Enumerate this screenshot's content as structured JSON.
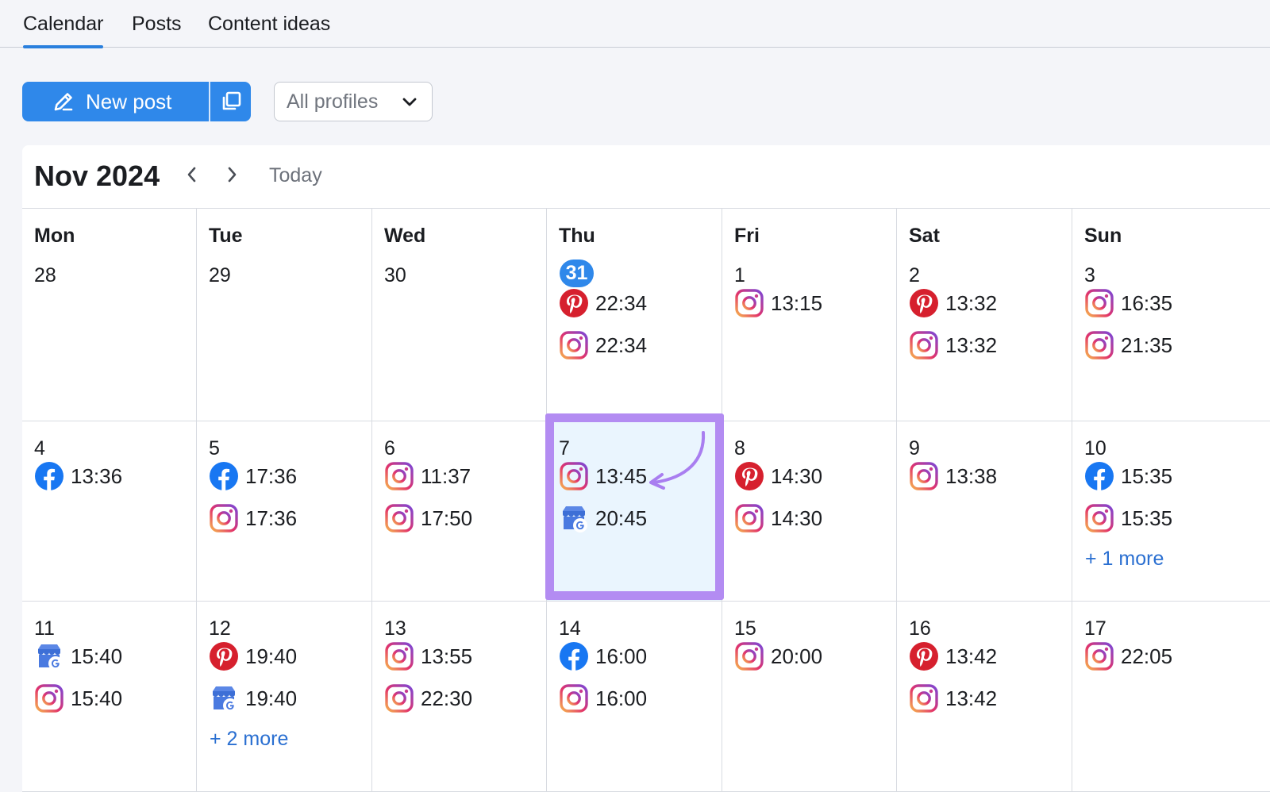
{
  "tabs": [
    {
      "label": "Calendar",
      "active": true
    },
    {
      "label": "Posts",
      "active": false
    },
    {
      "label": "Content ideas",
      "active": false
    }
  ],
  "toolbar": {
    "new_post_label": "New post",
    "profiles_label": "All profiles"
  },
  "calendar": {
    "month_label": "Nov 2024",
    "today_label": "Today",
    "weekdays": [
      "Mon",
      "Tue",
      "Wed",
      "Thu",
      "Fri",
      "Sat",
      "Sun"
    ],
    "weeks": [
      [
        {
          "day": "28",
          "posts": []
        },
        {
          "day": "29",
          "posts": []
        },
        {
          "day": "30",
          "posts": []
        },
        {
          "day": "31",
          "today": true,
          "posts": [
            {
              "platform": "pinterest",
              "time": "22:34"
            },
            {
              "platform": "instagram",
              "time": "22:34"
            }
          ]
        },
        {
          "day": "1",
          "posts": [
            {
              "platform": "instagram",
              "time": "13:15"
            }
          ]
        },
        {
          "day": "2",
          "posts": [
            {
              "platform": "pinterest",
              "time": "13:32"
            },
            {
              "platform": "instagram",
              "time": "13:32"
            }
          ]
        },
        {
          "day": "3",
          "posts": [
            {
              "platform": "instagram",
              "time": "16:35"
            },
            {
              "platform": "instagram",
              "time": "21:35"
            }
          ]
        }
      ],
      [
        {
          "day": "4",
          "posts": [
            {
              "platform": "facebook",
              "time": "13:36"
            }
          ]
        },
        {
          "day": "5",
          "posts": [
            {
              "platform": "facebook",
              "time": "17:36"
            },
            {
              "platform": "instagram",
              "time": "17:36"
            }
          ]
        },
        {
          "day": "6",
          "posts": [
            {
              "platform": "instagram",
              "time": "11:37"
            },
            {
              "platform": "instagram",
              "time": "17:50"
            }
          ]
        },
        {
          "day": "7",
          "highlight": true,
          "posts": [
            {
              "platform": "instagram",
              "time": "13:45"
            },
            {
              "platform": "google-business",
              "time": "20:45"
            }
          ]
        },
        {
          "day": "8",
          "posts": [
            {
              "platform": "pinterest",
              "time": "14:30"
            },
            {
              "platform": "instagram",
              "time": "14:30"
            }
          ]
        },
        {
          "day": "9",
          "posts": [
            {
              "platform": "instagram",
              "time": "13:38"
            }
          ]
        },
        {
          "day": "10",
          "posts": [
            {
              "platform": "facebook",
              "time": "15:35"
            },
            {
              "platform": "instagram",
              "time": "15:35"
            }
          ],
          "more": "+ 1 more"
        }
      ],
      [
        {
          "day": "11",
          "posts": [
            {
              "platform": "google-business",
              "time": "15:40"
            },
            {
              "platform": "instagram",
              "time": "15:40"
            }
          ]
        },
        {
          "day": "12",
          "posts": [
            {
              "platform": "pinterest",
              "time": "19:40"
            },
            {
              "platform": "google-business",
              "time": "19:40"
            }
          ],
          "more": "+ 2 more"
        },
        {
          "day": "13",
          "posts": [
            {
              "platform": "instagram",
              "time": "13:55"
            },
            {
              "platform": "instagram",
              "time": "22:30"
            }
          ]
        },
        {
          "day": "14",
          "posts": [
            {
              "platform": "facebook",
              "time": "16:00"
            },
            {
              "platform": "instagram",
              "time": "16:00"
            }
          ]
        },
        {
          "day": "15",
          "posts": [
            {
              "platform": "instagram",
              "time": "20:00"
            }
          ]
        },
        {
          "day": "16",
          "posts": [
            {
              "platform": "pinterest",
              "time": "13:42"
            },
            {
              "platform": "instagram",
              "time": "13:42"
            }
          ]
        },
        {
          "day": "17",
          "posts": [
            {
              "platform": "instagram",
              "time": "22:05"
            }
          ]
        }
      ]
    ]
  },
  "colors": {
    "accent": "#2f88ea",
    "highlight_border": "#b38cf2",
    "highlight_bg": "#eaf5fe",
    "link": "#2a6fd1"
  }
}
